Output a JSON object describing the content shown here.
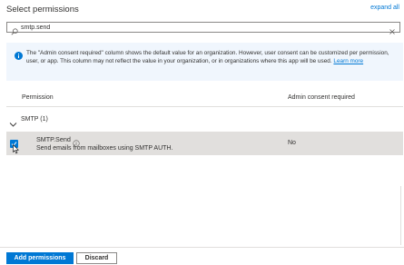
{
  "header": {
    "title": "Select permissions",
    "expand_all": "expand all"
  },
  "search": {
    "value": "smtp.send",
    "placeholder": ""
  },
  "info": {
    "message": "The \"Admin consent required\" column shows the default value for an organization. However, user consent can be customized per permission, user, or app. This column may not reflect the value in your organization, or in organizations where this app will be used.",
    "learn_more": "Learn more"
  },
  "table": {
    "columns": [
      "Permission",
      "Admin consent required"
    ],
    "group": {
      "label": "SMTP (1)",
      "expanded": true
    },
    "rows": [
      {
        "name": "SMTP.Send",
        "description": "Send emails from mailboxes using SMTP AUTH.",
        "admin_consent": "No",
        "checked": true
      }
    ]
  },
  "footer": {
    "add_label": "Add permissions",
    "discard_label": "Discard"
  },
  "colors": {
    "accent": "#0078d4",
    "info_bg": "#f0f6fd",
    "selected_row_bg": "#e1dfdd",
    "text": "#323130"
  },
  "icons": {
    "search": "search-icon",
    "clear": "close-icon",
    "info": "info-icon",
    "chevron": "chevron-down-icon",
    "tooltip": "info-circle-icon",
    "checkbox": "checkmark-icon",
    "cursor": "mouse-pointer-icon"
  }
}
